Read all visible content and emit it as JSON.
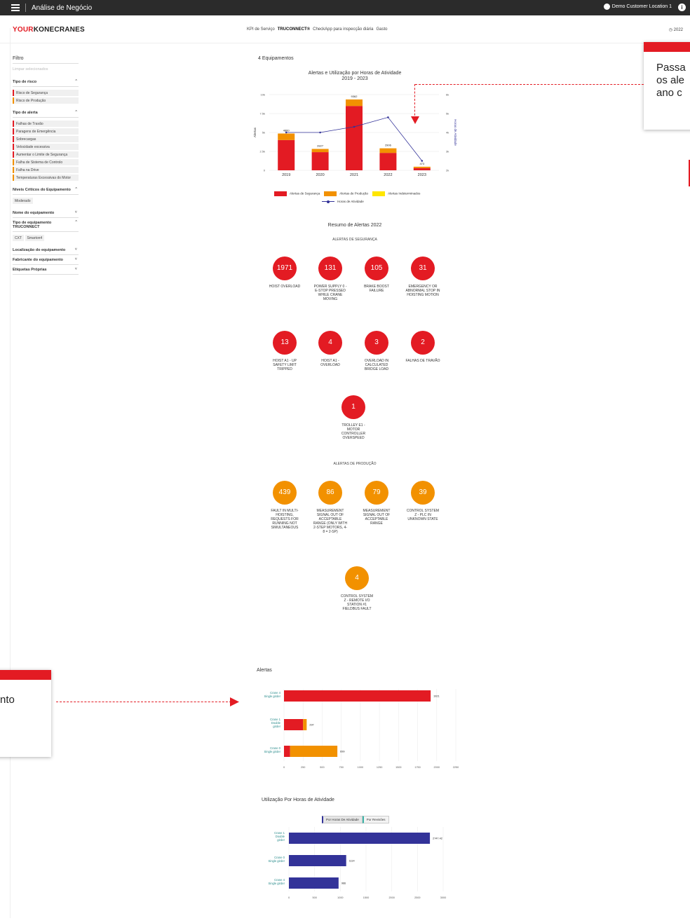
{
  "topbar": {
    "title": "Análise de Negócio",
    "location": "Demo Customer Location 1",
    "info_icon": "info-icon"
  },
  "header": {
    "logo_your": "YOUR",
    "logo_kc": "KONECRANES",
    "nav": [
      "KPI de Serviço",
      "TRUCONNECT®",
      "CheckApp para inspecção diária",
      "Gasto"
    ],
    "year": "2022"
  },
  "sidebar": {
    "filter_title": "Filtro",
    "clear": "Limpar selecionados",
    "tipo_risco": {
      "label": "Tipo de risco",
      "items": [
        "Risco de Segurança",
        "Risco de Produção"
      ]
    },
    "tipo_alerta": {
      "label": "Tipo de alerta",
      "items": [
        "Falhas de Travão",
        "Paragens de Emergência",
        "Sobrecargas",
        "Velocidade excessiva",
        "Aumentar o Limite de Segurança",
        "Falha de Sistema de Controlo",
        "Falha na Drive",
        "Temperaturas Excessivas do Motor"
      ]
    },
    "niveis": {
      "label": "Níveis Críticos do Equipamento",
      "items": [
        "Moderado"
      ]
    },
    "nome": {
      "label": "Nome do equipamento"
    },
    "tipo_equip": {
      "label": "Tipo de equipamento TRUCONNECT",
      "items": [
        "CXT",
        "Smarton4"
      ]
    },
    "localizacao": {
      "label": "Localização do equipamento"
    },
    "fabricante": {
      "label": "Fabricante do equipamento"
    },
    "etiquetas": {
      "label": "Etiquetas Próprias"
    }
  },
  "main": {
    "equip_count": "4 Equipamentos",
    "chart1_title": "Alertas e Utilização por Horas de Atividade",
    "chart1_subtitle": "2019 - 2023",
    "legend": {
      "seg": "Alertas de Segurança",
      "prod": "Alertas de Produção",
      "indet": "Alertas Indeterminados",
      "horas": "Horas de Atividade"
    },
    "resumo_title": "Resumo de Alertas 2022",
    "seg_head": "ALERTAS DE SEGURANÇA",
    "prod_head": "ALERTAS DE PRODUÇÃO",
    "seg_alerts": [
      {
        "value": "1971",
        "label": "HOIST OVERLOAD"
      },
      {
        "value": "131",
        "label": "POWER SUPPLY 0 - E-STOP PRESSED WHILE CRANE MOVING"
      },
      {
        "value": "105",
        "label": "BRAKE BOOST FAILURE"
      },
      {
        "value": "31",
        "label": "EMERGENCY OR ABNORMAL STOP IN HOISTING MOTION"
      },
      {
        "value": "13",
        "label": "HOIST A1 - UP SAFETY LIMIT TRIPPED"
      },
      {
        "value": "4",
        "label": "HOIST A1 - OVERLOAD"
      },
      {
        "value": "3",
        "label": "OVERLOAD IN CALCULATED BRIDGE LOAD"
      },
      {
        "value": "2",
        "label": "FALHAS DE TRAVÃO"
      },
      {
        "value": "1",
        "label": "TROLLEY E1 - MOTOR CONTROLLER OVERSPEED"
      }
    ],
    "prod_alerts": [
      {
        "value": "439",
        "label": "FAULT IN MULTI-HOISTING, REQUESTS FOR RUNNING NOT SIMULTANEOUS"
      },
      {
        "value": "86",
        "label": "MEASUREMENT SIGNAL OUT OF ACCEPTABLE RANGE (ONLY WITH 2-STEP MOTORS, 4-8 = 2-SP)"
      },
      {
        "value": "79",
        "label": "MEASUREMENT SIGNAL OUT OF ACCEPTABLE RANGE"
      },
      {
        "value": "39",
        "label": "CONTROL SYSTEM Z - PLC IN UNKNOWN STATE"
      },
      {
        "value": "4",
        "label": "CONTROL SYSTEM Z - REMOTE I/O STATION #1 FIELDBUS FAULT"
      }
    ],
    "alertas_title": "Alertas",
    "util_title": "Utilização Por Horas de Atividade",
    "util_tabs": [
      "Por Horas De Atividade",
      "Por Revisões"
    ]
  },
  "callouts": {
    "c1": [
      "Passa",
      "os ale",
      "ano c"
    ],
    "c2": "nto"
  },
  "colors": {
    "red": "#e31b23",
    "orange": "#f29100",
    "yellow": "#ffe600",
    "navy": "#333399"
  },
  "chart_data": [
    {
      "type": "bar",
      "title": "Alertas e Utilização por Horas de Atividade",
      "subtitle": "2019 - 2023",
      "categories": [
        "2019",
        "2020",
        "2021",
        "2022",
        "2023"
      ],
      "stacked": true,
      "ylabel": "Alertas",
      "y2label": "Horas de Atividade",
      "ylim": [
        0,
        10000
      ],
      "yticks": [
        "0",
        "2.5k",
        "5k",
        "7.5k",
        "10k"
      ],
      "y2ticks": [
        "2k",
        "3k",
        "4k",
        "5k",
        "6k"
      ],
      "totals": [
        "4860",
        "2827",
        "9362",
        "2906",
        "473"
      ],
      "series": [
        {
          "name": "Alertas de Segurança",
          "values": [
            4000,
            2400,
            8500,
            2300,
            300
          ]
        },
        {
          "name": "Alertas de Produção",
          "values": [
            860,
            427,
            862,
            606,
            173
          ]
        },
        {
          "name": "Alertas Indeterminados",
          "values": [
            0,
            0,
            0,
            0,
            0
          ]
        },
        {
          "name": "Horas de Atividade",
          "values": [
            4000,
            4000,
            4300,
            4800,
            2500
          ],
          "axis": "right"
        }
      ]
    },
    {
      "type": "bar",
      "title": "Alertas",
      "orientation": "horizontal",
      "categories": [
        [
          "Crane 4",
          "Single girder"
        ],
        [
          "Crane 1",
          "Double",
          "girder"
        ],
        [
          "Crane 0",
          "Single girder"
        ]
      ],
      "xticks": [
        "0",
        "250",
        "500",
        "750",
        "1000",
        "1250",
        "1500",
        "1750",
        "2000",
        "2250"
      ],
      "xlim": [
        0,
        2250
      ],
      "totals": [
        "1921",
        "297",
        "699"
      ],
      "series": [
        {
          "name": "Alertas de Segurança",
          "values": [
            1921,
            250,
            80
          ]
        },
        {
          "name": "Alertas de Produção",
          "values": [
            0,
            47,
            619
          ]
        }
      ]
    },
    {
      "type": "bar",
      "title": "Utilização Por Horas de Atividade",
      "orientation": "horizontal",
      "categories": [
        [
          "Crane 1",
          "Double",
          "girder"
        ],
        [
          "Crane 0",
          "Single girder"
        ],
        [
          "Crane 4",
          "Single girder"
        ]
      ],
      "xticks": [
        "0",
        "500",
        "1000",
        "1500",
        "2000",
        "2500",
        "3000"
      ],
      "xlim": [
        0,
        3000
      ],
      "series": [
        {
          "name": "Por Horas De Atividade",
          "values": [
            2742,
            1114,
            966
          ],
          "labels": [
            "2747.42",
            "1114",
            "966"
          ]
        }
      ]
    }
  ]
}
